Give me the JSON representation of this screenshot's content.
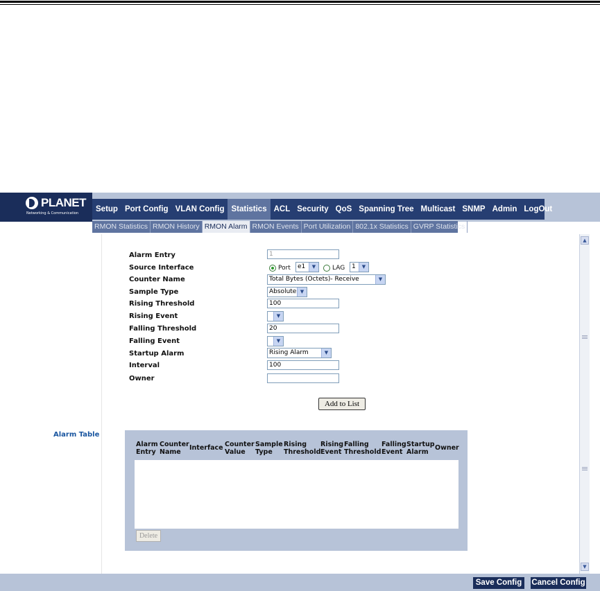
{
  "brand": {
    "name": "PLANET",
    "tagline": "Networking & Communication"
  },
  "main_nav": [
    "Setup",
    "Port Config",
    "VLAN Config",
    "Statistics",
    "ACL",
    "Security",
    "QoS",
    "Spanning Tree",
    "Multicast",
    "SNMP",
    "Admin",
    "LogOut"
  ],
  "main_nav_active": "Statistics",
  "sub_nav": [
    "RMON Statistics",
    "RMON History",
    "RMON Alarm",
    "RMON Events",
    "Port Utilization",
    "802.1x Statistics",
    "GVRP Statistics"
  ],
  "sub_nav_active": "RMON Alarm",
  "form": {
    "alarm_entry": {
      "label": "Alarm Entry",
      "value": "1"
    },
    "source_interface": {
      "label": "Source Interface",
      "port_label": "Port",
      "port_value": "e1",
      "lag_label": "LAG",
      "lag_value": "1",
      "selected": "Port"
    },
    "counter_name": {
      "label": "Counter Name",
      "value": "Total Bytes (Octets)- Receive"
    },
    "sample_type": {
      "label": "Sample Type",
      "value": "Absolute"
    },
    "rising_threshold": {
      "label": "Rising Threshold",
      "value": "100"
    },
    "rising_event": {
      "label": "Rising Event",
      "value": ""
    },
    "falling_threshold": {
      "label": "Falling Threshold",
      "value": "20"
    },
    "falling_event": {
      "label": "Falling Event",
      "value": ""
    },
    "startup_alarm": {
      "label": "Startup Alarm",
      "value": "Rising Alarm"
    },
    "interval": {
      "label": "Interval",
      "value": "100"
    },
    "owner": {
      "label": "Owner",
      "value": ""
    },
    "add_button": "Add to List"
  },
  "alarm_table": {
    "title": "Alarm Table",
    "columns": [
      [
        "Alarm",
        "Entry"
      ],
      [
        "Counter",
        "Name"
      ],
      [
        "",
        "Interface"
      ],
      [
        "Counter",
        "Value"
      ],
      [
        "Sample",
        "Type"
      ],
      [
        "Rising",
        "Threshold"
      ],
      [
        "Rising",
        "Event"
      ],
      [
        "Falling",
        "Threshold"
      ],
      [
        "Falling",
        "Event"
      ],
      [
        "Startup",
        "Alarm"
      ],
      [
        "",
        "Owner"
      ]
    ],
    "rows": [],
    "delete_button": "Delete"
  },
  "footer": {
    "save": "Save Config",
    "cancel": "Cancel Config"
  },
  "colors": {
    "nav_bg": "#263e72",
    "nav_active": "#5f74a0",
    "header_band": "#b7c3d8",
    "link_blue": "#1a56a0"
  }
}
